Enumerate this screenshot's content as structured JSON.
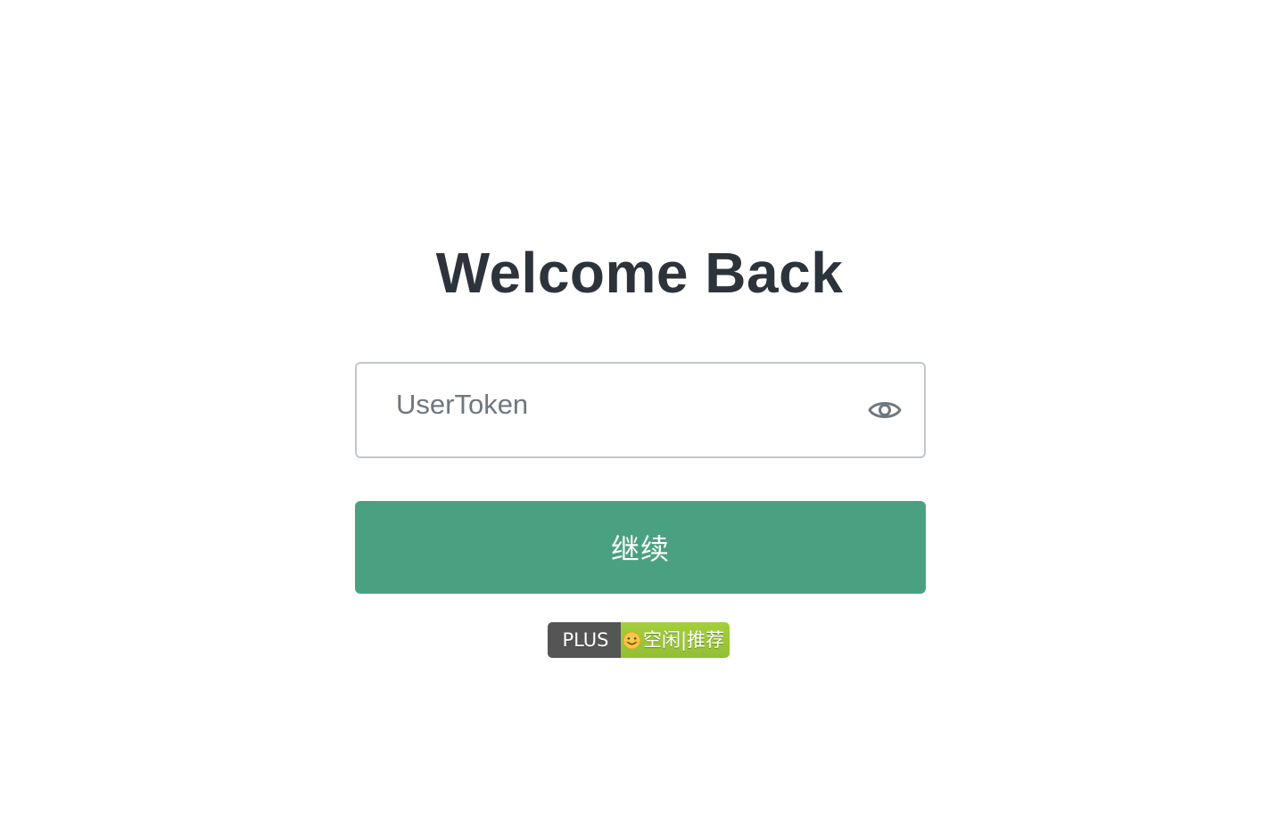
{
  "heading": "Welcome Back",
  "token_input": {
    "placeholder": "UserToken",
    "value": "",
    "toggle_icon": "eye-icon"
  },
  "continue_button": {
    "label": "继续",
    "color": "#4aa181"
  },
  "status_badge": {
    "label": "PLUS",
    "status_text": "空闲|推荐",
    "status_icon": "smiling-face-icon",
    "label_color": "#555555",
    "status_color": "#97ca00"
  }
}
